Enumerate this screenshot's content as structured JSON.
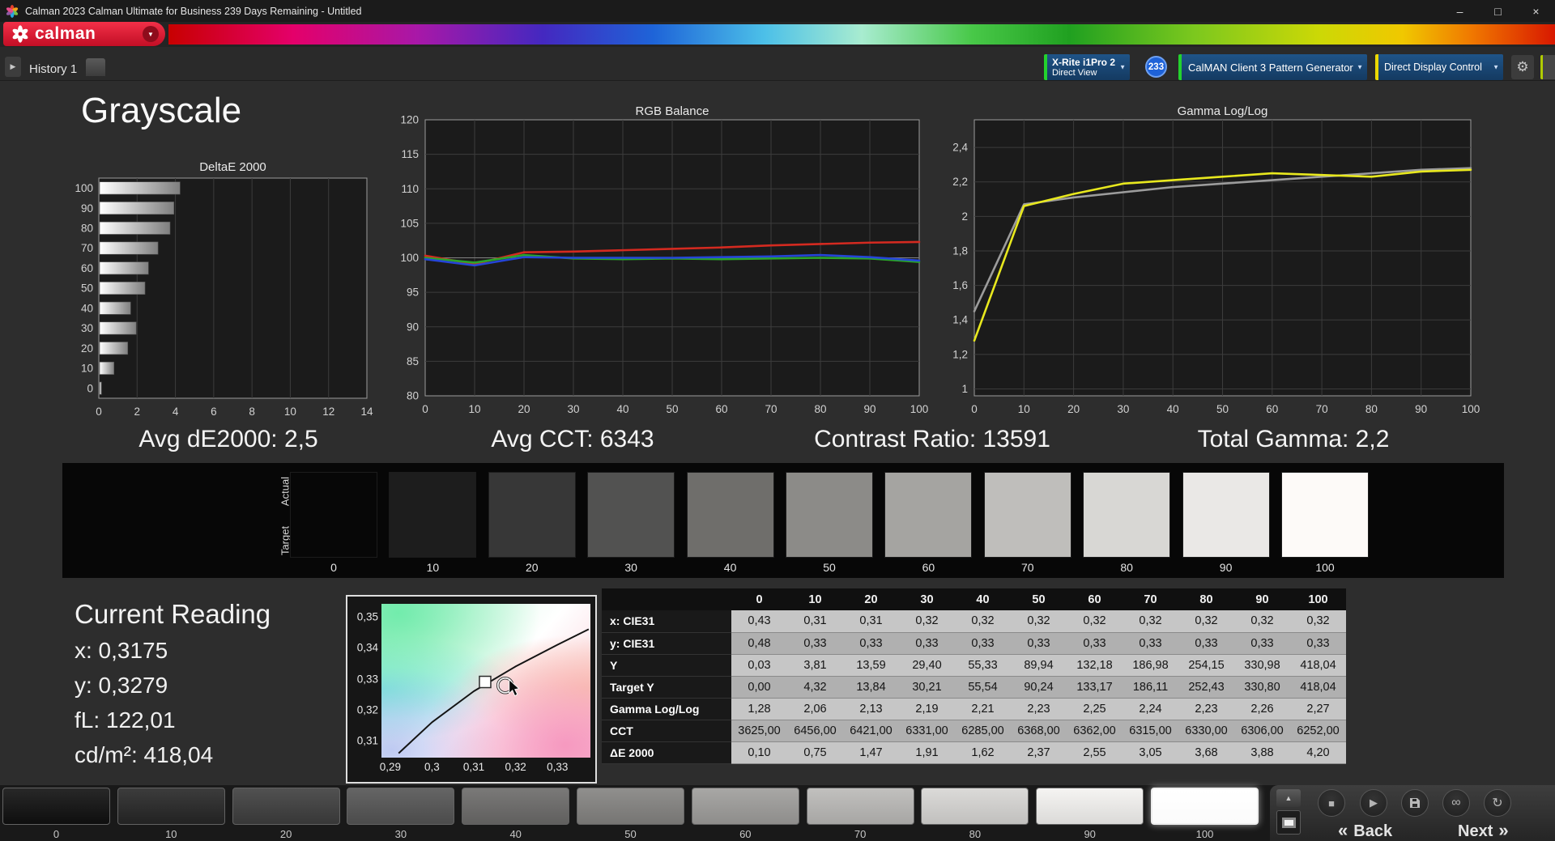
{
  "window": {
    "title": "Calman 2023 Calman Ultimate for Business 239 Days Remaining  - Untitled",
    "minimize_glyph": "–",
    "maximize_glyph": "□",
    "close_glyph": "×"
  },
  "brand": {
    "name": "calman"
  },
  "icons": {
    "caret_down": "▼",
    "chevron_right": "▶",
    "gear": "⚙",
    "stop": "■",
    "play": "▶",
    "link": "∞",
    "refresh": "↻",
    "eject": "▲",
    "chevrons_left": "«",
    "chevrons_right": "»"
  },
  "toolbar": {
    "history_tab": "History 1",
    "meter": {
      "line1": "X-Rite i1Pro 2",
      "line2": "Direct View"
    },
    "meter_badge": "233",
    "pattern_generator": "CalMAN Client 3 Pattern Generator",
    "display_control": "Direct Display Control"
  },
  "page": {
    "title": "Grayscale"
  },
  "stats": [
    "Avg dE2000: 2,5",
    "Avg CCT: 6343",
    "Contrast Ratio: 13591",
    "Total Gamma: 2,2"
  ],
  "swatches": {
    "actual_label": "Actual",
    "target_label": "Target",
    "items": [
      {
        "label": "0",
        "color": "#070707"
      },
      {
        "label": "10",
        "color": "#1d1d1d"
      },
      {
        "label": "20",
        "color": "#373737"
      },
      {
        "label": "30",
        "color": "#525251"
      },
      {
        "label": "40",
        "color": "#6f6e6b"
      },
      {
        "label": "50",
        "color": "#8c8b88"
      },
      {
        "label": "60",
        "color": "#a5a4a1"
      },
      {
        "label": "70",
        "color": "#bfbebb"
      },
      {
        "label": "80",
        "color": "#d8d7d4"
      },
      {
        "label": "90",
        "color": "#eae8e6"
      },
      {
        "label": "100",
        "color": "#fdfaf8"
      }
    ]
  },
  "current_reading": {
    "title": "Current Reading",
    "lines": [
      "x: 0,3175",
      "y: 0,3279",
      "fL: 122,01",
      "cd/m²: 418,04"
    ]
  },
  "table": {
    "col_headers": [
      "",
      "0",
      "10",
      "20",
      "30",
      "40",
      "50",
      "60",
      "70",
      "80",
      "90",
      "100"
    ],
    "rows": [
      {
        "label": "x: CIE31",
        "values": [
          "0,43",
          "0,31",
          "0,31",
          "0,32",
          "0,32",
          "0,32",
          "0,32",
          "0,32",
          "0,32",
          "0,32",
          "0,32"
        ]
      },
      {
        "label": "y: CIE31",
        "values": [
          "0,48",
          "0,33",
          "0,33",
          "0,33",
          "0,33",
          "0,33",
          "0,33",
          "0,33",
          "0,33",
          "0,33",
          "0,33"
        ]
      },
      {
        "label": "Y",
        "values": [
          "0,03",
          "3,81",
          "13,59",
          "29,40",
          "55,33",
          "89,94",
          "132,18",
          "186,98",
          "254,15",
          "330,98",
          "418,04"
        ]
      },
      {
        "label": "Target Y",
        "values": [
          "0,00",
          "4,32",
          "13,84",
          "30,21",
          "55,54",
          "90,24",
          "133,17",
          "186,11",
          "252,43",
          "330,80",
          "418,04"
        ]
      },
      {
        "label": "Gamma Log/Log",
        "values": [
          "1,28",
          "2,06",
          "2,13",
          "2,19",
          "2,21",
          "2,23",
          "2,25",
          "2,24",
          "2,23",
          "2,26",
          "2,27"
        ]
      },
      {
        "label": "CCT",
        "values": [
          "3625,00",
          "6456,00",
          "6421,00",
          "6331,00",
          "6285,00",
          "6368,00",
          "6362,00",
          "6315,00",
          "6330,00",
          "6306,00",
          "6252,00"
        ]
      },
      {
        "label": "ΔE 2000",
        "values": [
          "0,10",
          "0,75",
          "1,47",
          "1,91",
          "1,62",
          "2,37",
          "2,55",
          "3,05",
          "3,68",
          "3,88",
          "4,20"
        ]
      }
    ]
  },
  "bottom": {
    "selected": "100",
    "back_label": "Back",
    "next_label": "Next",
    "patches": [
      {
        "label": "0",
        "color": "#0e0e0e"
      },
      {
        "label": "10",
        "color": "#222222"
      },
      {
        "label": "20",
        "color": "#373737"
      },
      {
        "label": "30",
        "color": "#4b4b4b"
      },
      {
        "label": "40",
        "color": "#605f5e"
      },
      {
        "label": "50",
        "color": "#767573"
      },
      {
        "label": "60",
        "color": "#8e8d8b"
      },
      {
        "label": "70",
        "color": "#a7a6a4"
      },
      {
        "label": "80",
        "color": "#c1c0be"
      },
      {
        "label": "90",
        "color": "#dbdad8"
      },
      {
        "label": "100",
        "color": "#fbfbfb"
      }
    ]
  },
  "chart_data": [
    {
      "id": "deltae",
      "type": "bar",
      "orientation": "horizontal",
      "title": "DeltaE 2000",
      "categories": [
        "100",
        "90",
        "80",
        "70",
        "60",
        "50",
        "40",
        "30",
        "20",
        "10",
        "0"
      ],
      "values": [
        4.2,
        3.88,
        3.68,
        3.05,
        2.55,
        2.37,
        1.62,
        1.91,
        1.47,
        0.75,
        0.1
      ],
      "xlim": [
        0,
        14
      ],
      "xticks": [
        0,
        2,
        4,
        6,
        8,
        10,
        12,
        14
      ]
    },
    {
      "id": "rgb_balance",
      "type": "line",
      "title": "RGB Balance",
      "x": [
        0,
        10,
        20,
        30,
        40,
        50,
        60,
        70,
        80,
        90,
        100
      ],
      "ylim": [
        80,
        120
      ],
      "yticks": [
        80,
        85,
        90,
        95,
        100,
        105,
        110,
        115,
        120
      ],
      "emphasis": 100,
      "series": [
        {
          "name": "red",
          "color": "#d42a20",
          "values": [
            100.3,
            99.1,
            100.8,
            100.9,
            101.1,
            101.3,
            101.5,
            101.8,
            102.0,
            102.2,
            102.3
          ]
        },
        {
          "name": "green",
          "color": "#2aa52a",
          "values": [
            100.0,
            99.3,
            100.4,
            99.9,
            99.8,
            99.9,
            99.8,
            99.9,
            100.0,
            99.9,
            99.4
          ]
        },
        {
          "name": "blue",
          "color": "#2545d8",
          "values": [
            99.8,
            98.9,
            100.1,
            100.0,
            100.0,
            100.0,
            100.1,
            100.2,
            100.4,
            100.1,
            99.6
          ]
        }
      ]
    },
    {
      "id": "gamma_loglog",
      "type": "line",
      "title": "Gamma Log/Log",
      "x": [
        0,
        10,
        20,
        30,
        40,
        50,
        60,
        70,
        80,
        90,
        100
      ],
      "ylim": [
        0.96,
        2.56
      ],
      "yticks": [
        1,
        1.2,
        1.4,
        1.6,
        1.8,
        2,
        2.2,
        2.4
      ],
      "ytick_labels": [
        "1",
        "1,2",
        "1,4",
        "1,6",
        "1,8",
        "2",
        "2,2",
        "2,4"
      ],
      "series": [
        {
          "name": "target",
          "color": "#9c9c9c",
          "values": [
            1.45,
            2.07,
            2.11,
            2.14,
            2.17,
            2.19,
            2.21,
            2.23,
            2.25,
            2.27,
            2.28
          ]
        },
        {
          "name": "measured",
          "color": "#e8e81e",
          "values": [
            1.28,
            2.06,
            2.13,
            2.19,
            2.21,
            2.23,
            2.25,
            2.24,
            2.23,
            2.26,
            2.27
          ]
        }
      ]
    },
    {
      "id": "cie_chromaticity",
      "type": "scatter",
      "xtick_labels": [
        "0,29",
        "0,3",
        "0,31",
        "0,32",
        "0,33"
      ],
      "ytick_labels": [
        "0,35",
        "0,34",
        "0,33",
        "0,32",
        "0,31"
      ],
      "points": [
        {
          "name": "target",
          "x": 0.3127,
          "y": 0.329
        },
        {
          "name": "measured",
          "x": 0.3175,
          "y": 0.3279
        }
      ],
      "locus": [
        [
          0.292,
          0.306
        ],
        [
          0.3,
          0.316
        ],
        [
          0.31,
          0.326
        ],
        [
          0.32,
          0.334
        ],
        [
          0.33,
          0.341
        ],
        [
          0.3375,
          0.346
        ]
      ]
    }
  ]
}
